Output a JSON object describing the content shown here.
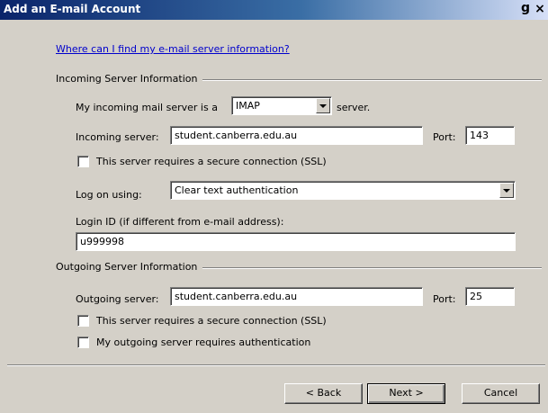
{
  "window": {
    "title": "Add an E-mail Account",
    "title_right_fragment": "g",
    "close_glyph": "×"
  },
  "help_link": "Where can I find my e-mail server information?",
  "incoming": {
    "group_label": "Incoming Server Information",
    "server_type_prefix": "My incoming mail server is a",
    "server_type_value": "IMAP",
    "server_type_suffix": "server.",
    "server_label": "Incoming server:",
    "server_value": "student.canberra.edu.au",
    "port_label": "Port:",
    "port_value": "143",
    "ssl_label": "This server requires a secure connection (SSL)",
    "logon_label": "Log on using:",
    "logon_value": "Clear text authentication",
    "login_id_label": "Login ID (if different from e-mail address):",
    "login_id_value": "u999998"
  },
  "outgoing": {
    "group_label": "Outgoing Server Information",
    "server_label": "Outgoing server:",
    "server_value": "student.canberra.edu.au",
    "port_label": "Port:",
    "port_value": "25",
    "ssl_label": "This server requires a secure connection (SSL)",
    "auth_label": "My outgoing server requires authentication"
  },
  "buttons": {
    "back": "< Back",
    "next": "Next >",
    "cancel": "Cancel"
  }
}
